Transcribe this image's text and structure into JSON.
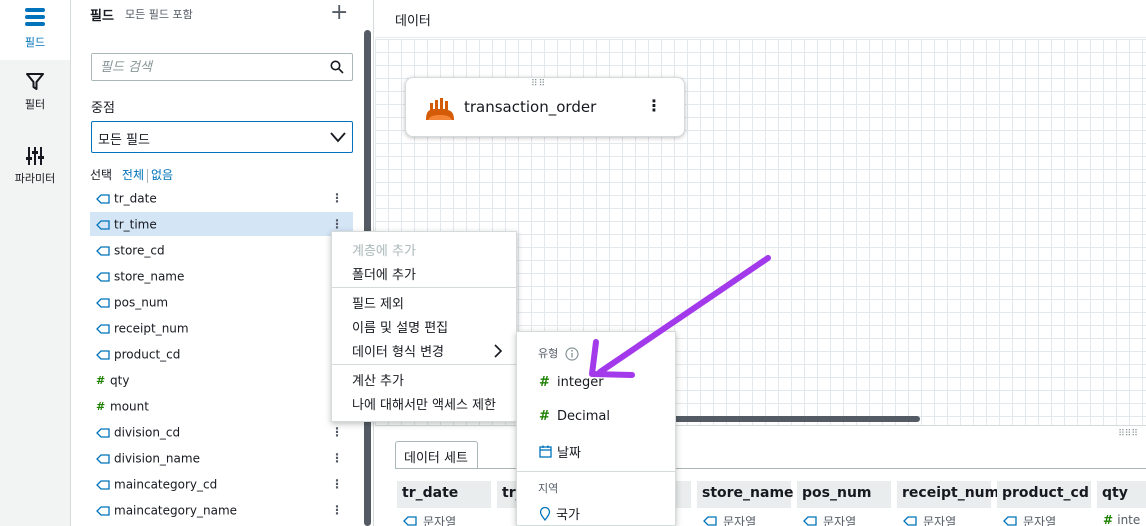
{
  "rail": {
    "fields_label": "필드",
    "filter_label": "필터",
    "params_label": "파라미터"
  },
  "panel": {
    "title": "필드",
    "subtitle": "모든 필드 포함",
    "search_placeholder": "필드 검색",
    "focus_label": "중점",
    "focus_value": "모든 필드",
    "select_label": "선택",
    "select_all": "전체",
    "select_none": "없음",
    "fields": [
      {
        "name": "tr_date",
        "type": "string"
      },
      {
        "name": "tr_time",
        "type": "string"
      },
      {
        "name": "store_cd",
        "type": "string"
      },
      {
        "name": "store_name",
        "type": "string"
      },
      {
        "name": "pos_num",
        "type": "string"
      },
      {
        "name": "receipt_num",
        "type": "string"
      },
      {
        "name": "product_cd",
        "type": "string"
      },
      {
        "name": "qty",
        "type": "number"
      },
      {
        "name": "mount",
        "type": "number"
      },
      {
        "name": "division_cd",
        "type": "string"
      },
      {
        "name": "division_name",
        "type": "string"
      },
      {
        "name": "maincategory_cd",
        "type": "string"
      },
      {
        "name": "maincategory_name",
        "type": "string"
      }
    ]
  },
  "main": {
    "title": "데이터",
    "node_label": "transaction_order"
  },
  "bottom": {
    "tab_label": "데이터 세트",
    "columns": [
      "tr_date",
      "tr_",
      "",
      "store_name",
      "pos_num",
      "receipt_num",
      "product_cd",
      "qty"
    ],
    "cell_type": "문자열",
    "cell_type_last": "inte"
  },
  "context_menu": {
    "add_to_hierarchy": "계층에 추가",
    "add_to_folder": "폴더에 추가",
    "exclude_field": "필드 제외",
    "edit_name_desc": "이름 및 설명 편집",
    "change_data_type": "데이터 형식 변경",
    "add_calculation": "계산 추가",
    "restrict_access": "나에 대해서만 액세스 제한"
  },
  "submenu": {
    "type_header": "유형",
    "integer": "integer",
    "decimal": "Decimal",
    "date": "날짜",
    "region_header": "지역",
    "country": "국가"
  },
  "colors": {
    "accent": "#0073bb",
    "number_type": "#1d8102",
    "annotation_arrow": "#a239ea"
  }
}
